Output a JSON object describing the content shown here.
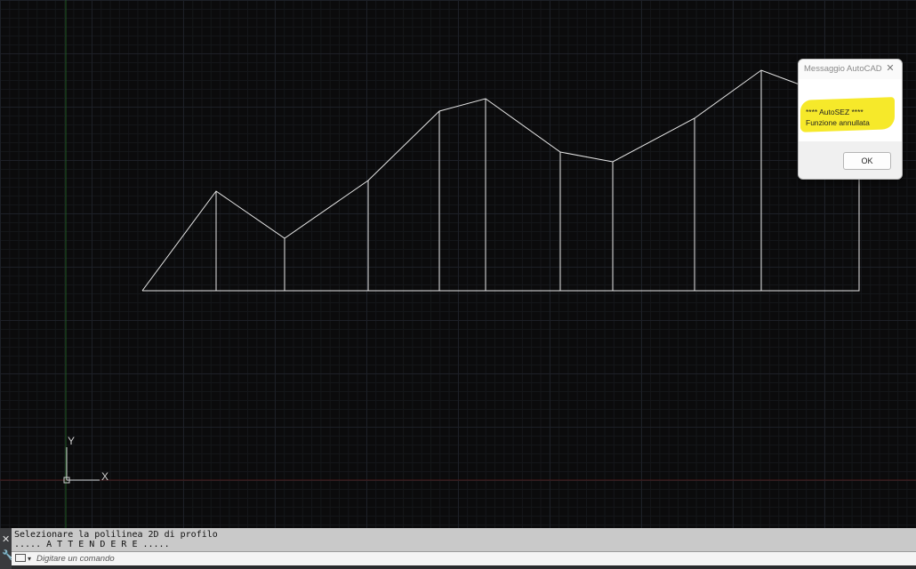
{
  "viewport": {
    "ucs_y_label": "Y",
    "ucs_x_label": "X"
  },
  "dialog": {
    "title": "Messaggio AutoCAD",
    "close_icon": "close-icon",
    "line1": "**** AutoSEZ ****",
    "line2": "Funzione annullata",
    "ok_label": "OK",
    "highlight_color": "#f6e92a"
  },
  "command_line": {
    "history": [
      "Selezionare la polilinea 2D di profilo",
      "..... A T T E N D E R E ....."
    ],
    "input_placeholder": "Digitare un comando",
    "close_icon": "close-icon",
    "settings_icon": "wrench-icon"
  },
  "colors": {
    "canvas_background": "#0b0b0c",
    "geometry": "#e6e6e6",
    "y_axis": "#1f5a24",
    "x_axis": "#4a1a1a"
  }
}
